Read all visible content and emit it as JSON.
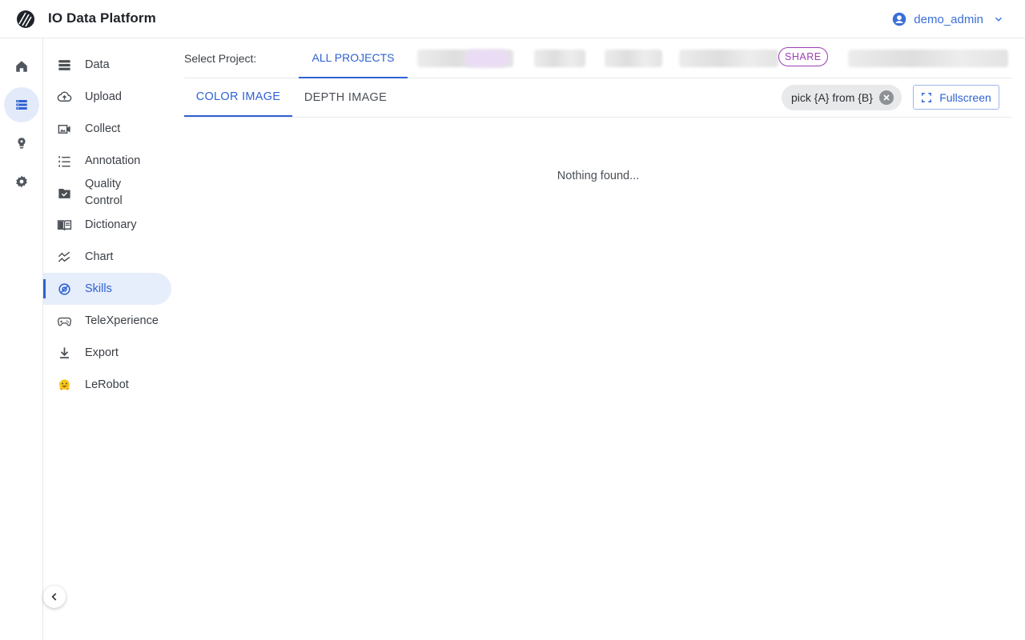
{
  "app": {
    "title": "IO Data Platform"
  },
  "user": {
    "name": "demo_admin"
  },
  "rail": {
    "items": [
      {
        "icon": "home-icon"
      },
      {
        "icon": "database-icon",
        "active": true
      },
      {
        "icon": "bulb-icon"
      },
      {
        "icon": "gear-icon"
      }
    ]
  },
  "sidebar": {
    "items": [
      {
        "label": "Data",
        "icon": "storage-icon"
      },
      {
        "label": "Upload",
        "icon": "cloud-upload-icon"
      },
      {
        "label": "Collect",
        "icon": "video-camera-icon"
      },
      {
        "label": "Annotation",
        "icon": "numbered-list-icon"
      },
      {
        "label": "Quality Control",
        "icon": "folder-check-icon"
      },
      {
        "label": "Dictionary",
        "icon": "book-icon"
      },
      {
        "label": "Chart",
        "icon": "chart-icon"
      },
      {
        "label": "Skills",
        "icon": "skills-icon",
        "active": true
      },
      {
        "label": "TeleXperience",
        "icon": "gamepad-icon"
      },
      {
        "label": "Export",
        "icon": "download-icon"
      },
      {
        "label": "LeRobot",
        "icon": "hugging-face-icon"
      }
    ]
  },
  "projects": {
    "label": "Select Project:",
    "active_tab": "ALL PROJECTS",
    "share_badge": "SHARE"
  },
  "image_tabs": {
    "color": "COLOR IMAGE",
    "depth": "DEPTH IMAGE"
  },
  "filter_chip": {
    "label": "pick {A} from {B}"
  },
  "fullscreen_button": {
    "label": "Fullscreen"
  },
  "empty_state": {
    "message": "Nothing found..."
  },
  "colors": {
    "accent": "#2f62d1",
    "share": "#9b3fb3",
    "active_bg": "#e6edfb"
  }
}
